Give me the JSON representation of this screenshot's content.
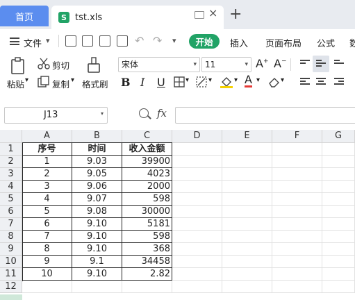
{
  "tabs": {
    "home_label": "首页",
    "file_icon_letter": "S",
    "file_name": "tst.xls",
    "close_glyph": "×",
    "add_glyph": "+"
  },
  "menu": {
    "file_label": "文件",
    "items": [
      "开始",
      "插入",
      "页面布局",
      "公式",
      "数"
    ]
  },
  "ribbon": {
    "paste_label": "粘贴",
    "cut_label": "剪切",
    "copy_label": "复制",
    "format_painter_label": "格式刷",
    "font_name": "宋体",
    "font_size": "11"
  },
  "formula_bar": {
    "name_box": "J13",
    "fx": "fx",
    "formula": ""
  },
  "sheet": {
    "columns": [
      "A",
      "B",
      "C",
      "D",
      "E",
      "F",
      "G"
    ],
    "rows": [
      "1",
      "2",
      "3",
      "4",
      "5",
      "6",
      "7",
      "8",
      "9",
      "10",
      "11",
      "12"
    ],
    "header": [
      "序号",
      "时间",
      "收入金额"
    ],
    "data": [
      [
        "1",
        "9.03",
        "39900"
      ],
      [
        "2",
        "9.05",
        "4023"
      ],
      [
        "3",
        "9.06",
        "2000"
      ],
      [
        "4",
        "9.07",
        "598"
      ],
      [
        "5",
        "9.08",
        "30000"
      ],
      [
        "6",
        "9.10",
        "5181"
      ],
      [
        "7",
        "9.10",
        "598"
      ],
      [
        "8",
        "9.10",
        "368"
      ],
      [
        "9",
        "9.1",
        "34458"
      ],
      [
        "10",
        "9.10",
        "2.82"
      ]
    ]
  },
  "colors": {
    "accent": "#5b8def",
    "brand_green": "#21a366"
  }
}
